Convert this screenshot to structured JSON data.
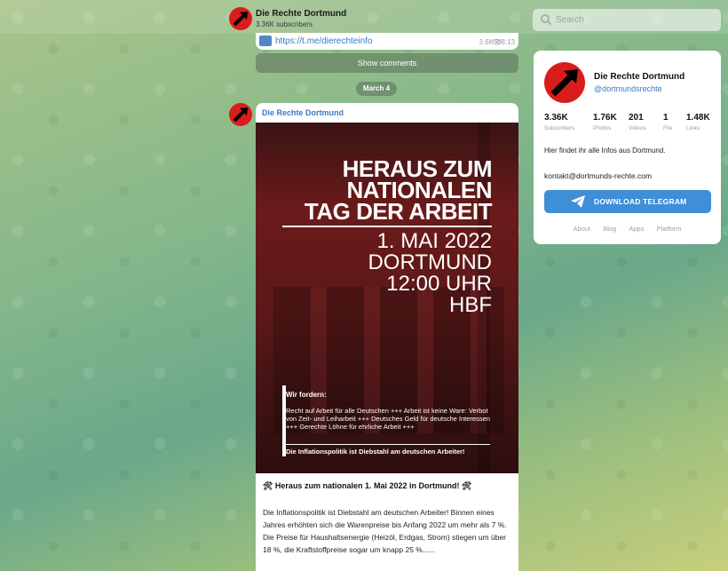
{
  "header": {
    "channel_name": "Die Rechte Dortmund",
    "subscribers": "3.36K subscribers"
  },
  "search": {
    "placeholder": "Search"
  },
  "link_message": {
    "url": "https://t.me/dierechteinfo",
    "views": "3.6K",
    "time": "08:13"
  },
  "show_comments": "Show comments",
  "date_separator": "March 4",
  "post": {
    "author": "Die Rechte Dortmund",
    "poster": {
      "line1": "HERAUS ZUM",
      "line2": "NATIONALEN",
      "line3": "TAG DER ARBEIT",
      "date": "1. MAI 2022",
      "city": "DORTMUND",
      "time": "12:00 UHR",
      "place": "HBF",
      "demands_title": "Wir fordern:",
      "demands_body": "Recht auf Arbeit für alle Deutschen +++ Arbeit ist keine Ware: Verbot von Zeit- und Leiharbeit +++ Deutsches Geld für deutsche Interessen +++ Gerechte Löhne für ehrliche Arbeit +++",
      "demands_footer": "Die Inflationspolitik ist Diebstahl am deutschen Arbeiter!"
    },
    "headline": "🛠 Heraus zum nationalen 1. Mai 2022 in Dortmund! 🛠",
    "body": "Die Inflationspolitik ist Diebstahl am deutschen Arbeiter! Binnen eines Jahres erhöhten sich die Warenpreise bis Anfang 2022 um mehr als 7 %. Die Preise für Haushaltsenergie (Heizöl, Erdgas, Strom) stiegen um über 18 %, die Kraftstoffpreise sogar um knapp 25 %......"
  },
  "card": {
    "name": "Die Rechte Dortmund",
    "handle": "@dortmundsrechte",
    "stats": [
      {
        "value": "3.36K",
        "label": "Subscribers"
      },
      {
        "value": "1.76K",
        "label": "Photos"
      },
      {
        "value": "201",
        "label": "Videos"
      },
      {
        "value": "1",
        "label": "File"
      },
      {
        "value": "1.48K",
        "label": "Links"
      }
    ],
    "description": "Hier findet ihr alle Infos aus Dortmund.",
    "email": "kontakt@dortmunds-rechte.com",
    "download_label": "DOWNLOAD TELEGRAM",
    "footer_links": [
      "About",
      "Blog",
      "Apps",
      "Platform"
    ]
  },
  "colors": {
    "accent": "#3f8ed8",
    "link": "#3a79c2",
    "avatar_red": "#d91c1c"
  }
}
